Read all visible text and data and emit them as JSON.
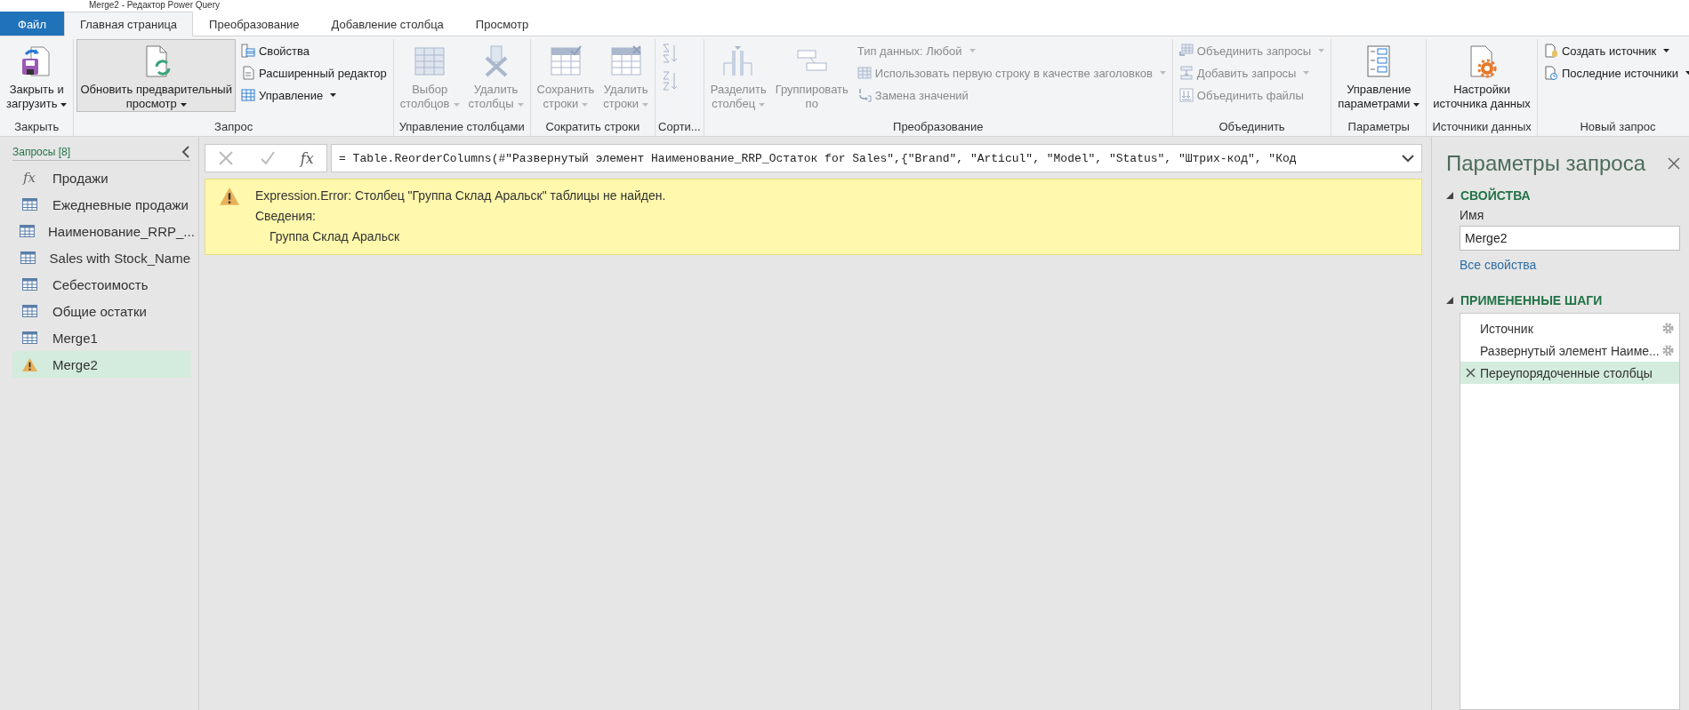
{
  "window": {
    "title": "Merge2 - Редактор Power Query"
  },
  "tabs": [
    {
      "label": "Файл",
      "kind": "file",
      "selected": false
    },
    {
      "label": "Главная страница",
      "kind": "tab",
      "selected": true
    },
    {
      "label": "Преобразование",
      "kind": "tab",
      "selected": false
    },
    {
      "label": "Добавление столбца",
      "kind": "tab",
      "selected": false
    },
    {
      "label": "Просмотр",
      "kind": "tab",
      "selected": false
    }
  ],
  "ribbon": {
    "groups": [
      {
        "label": "Закрыть",
        "items": [
          {
            "kind": "large",
            "label": "Закрыть и\nзагрузить",
            "dropdown": true,
            "disabled": false,
            "pressed": false
          }
        ]
      },
      {
        "label": "Запрос",
        "items": [
          {
            "kind": "large",
            "label": "Обновить предварительный\nпросмотр",
            "dropdown": true,
            "disabled": false,
            "pressed": true
          },
          {
            "kind": "stack",
            "items": [
              {
                "label": "Свойства",
                "dropdown": false,
                "disabled": false
              },
              {
                "label": "Расширенный редактор",
                "dropdown": false,
                "disabled": false
              },
              {
                "label": "Управление",
                "dropdown": true,
                "disabled": false
              }
            ]
          }
        ]
      },
      {
        "label": "Управление столбцами",
        "items": [
          {
            "kind": "large",
            "label": "Выбор\nстолбцов",
            "dropdown": true,
            "disabled": true,
            "pressed": false
          },
          {
            "kind": "large",
            "label": "Удалить\nстолбцы",
            "dropdown": true,
            "disabled": true,
            "pressed": false
          }
        ]
      },
      {
        "label": "Сократить строки",
        "items": [
          {
            "kind": "large",
            "label": "Сохранить\nстроки",
            "dropdown": true,
            "disabled": true,
            "pressed": false
          },
          {
            "kind": "large",
            "label": "Удалить\nстроки",
            "dropdown": true,
            "disabled": true,
            "pressed": false
          }
        ]
      },
      {
        "label": "Сорти...",
        "items": [
          {
            "kind": "sort",
            "disabled": true
          }
        ]
      },
      {
        "label": "Преобразование",
        "items": [
          {
            "kind": "large",
            "label": "Разделить\nстолбец",
            "dropdown": true,
            "disabled": true,
            "pressed": false
          },
          {
            "kind": "large",
            "label": "Группировать\nпо",
            "dropdown": false,
            "disabled": true,
            "pressed": false
          },
          {
            "kind": "stack",
            "items": [
              {
                "label": "Тип данных: Любой",
                "dropdown": true,
                "disabled": true
              },
              {
                "label": "Использовать первую строку в качестве заголовков",
                "dropdown": true,
                "disabled": true
              },
              {
                "label": "Замена значений",
                "dropdown": false,
                "disabled": true
              }
            ]
          }
        ]
      },
      {
        "label": "Объединить",
        "items": [
          {
            "kind": "stack",
            "items": [
              {
                "label": "Объединить запросы",
                "dropdown": true,
                "disabled": true
              },
              {
                "label": "Добавить запросы",
                "dropdown": true,
                "disabled": true
              },
              {
                "label": "Объединить файлы",
                "dropdown": false,
                "disabled": true
              }
            ]
          }
        ]
      },
      {
        "label": "Параметры",
        "items": [
          {
            "kind": "large",
            "label": "Управление\nпараметрами",
            "dropdown": true,
            "disabled": false,
            "pressed": false
          }
        ]
      },
      {
        "label": "Источники данных",
        "items": [
          {
            "kind": "large",
            "label": "Настройки\nисточника данных",
            "dropdown": false,
            "disabled": false,
            "pressed": false
          }
        ]
      },
      {
        "label": "Новый запрос",
        "items": [
          {
            "kind": "stack",
            "items": [
              {
                "label": "Создать источник",
                "dropdown": true,
                "disabled": false
              },
              {
                "label": "Последние источники",
                "dropdown": true,
                "disabled": false
              }
            ]
          }
        ]
      }
    ]
  },
  "queries": {
    "title": "Запросы [8]",
    "items": [
      {
        "name": "Продажи",
        "kind": "function",
        "icon_text": "fx",
        "selected": false
      },
      {
        "name": "Ежедневные продажи",
        "kind": "table",
        "selected": false
      },
      {
        "name": "Наименование_RRP_...",
        "kind": "table",
        "selected": false
      },
      {
        "name": "Sales with Stock_Name",
        "kind": "table",
        "selected": false
      },
      {
        "name": "Себестоимость",
        "kind": "table",
        "selected": false
      },
      {
        "name": "Общие остатки",
        "kind": "table",
        "selected": false
      },
      {
        "name": "Merge1",
        "kind": "table",
        "selected": false
      },
      {
        "name": "Merge2",
        "kind": "error",
        "selected": true
      }
    ]
  },
  "formula_bar": {
    "fx_label": "fx",
    "formula": "= Table.ReorderColumns(#\"Развернутый элемент Наименование_RRP_Остаток for Sales\",{\"Brand\", \"Articul\", \"Model\", \"Status\", \"Штрих-код\", \"Код"
  },
  "error": {
    "message": "Expression.Error: Столбец \"Группа Склад Аральск\" таблицы не найден.",
    "details_label": "Сведения:",
    "detail": "Группа Склад Аральск"
  },
  "query_settings": {
    "title": "Параметры запроса",
    "properties": {
      "heading": "СВОЙСТВА",
      "name_label": "Имя",
      "name_value": "Merge2",
      "all_properties_link": "Все свойства"
    },
    "steps": {
      "heading": "ПРИМЕНЕННЫЕ ШАГИ",
      "items": [
        {
          "name": "Источник",
          "settings": true,
          "error": false,
          "selected": false
        },
        {
          "name": "Развернутый элемент Наиме...",
          "settings": true,
          "error": false,
          "selected": false
        },
        {
          "name": "Переупорядоченные столбцы",
          "settings": false,
          "error": true,
          "selected": true
        }
      ]
    }
  }
}
